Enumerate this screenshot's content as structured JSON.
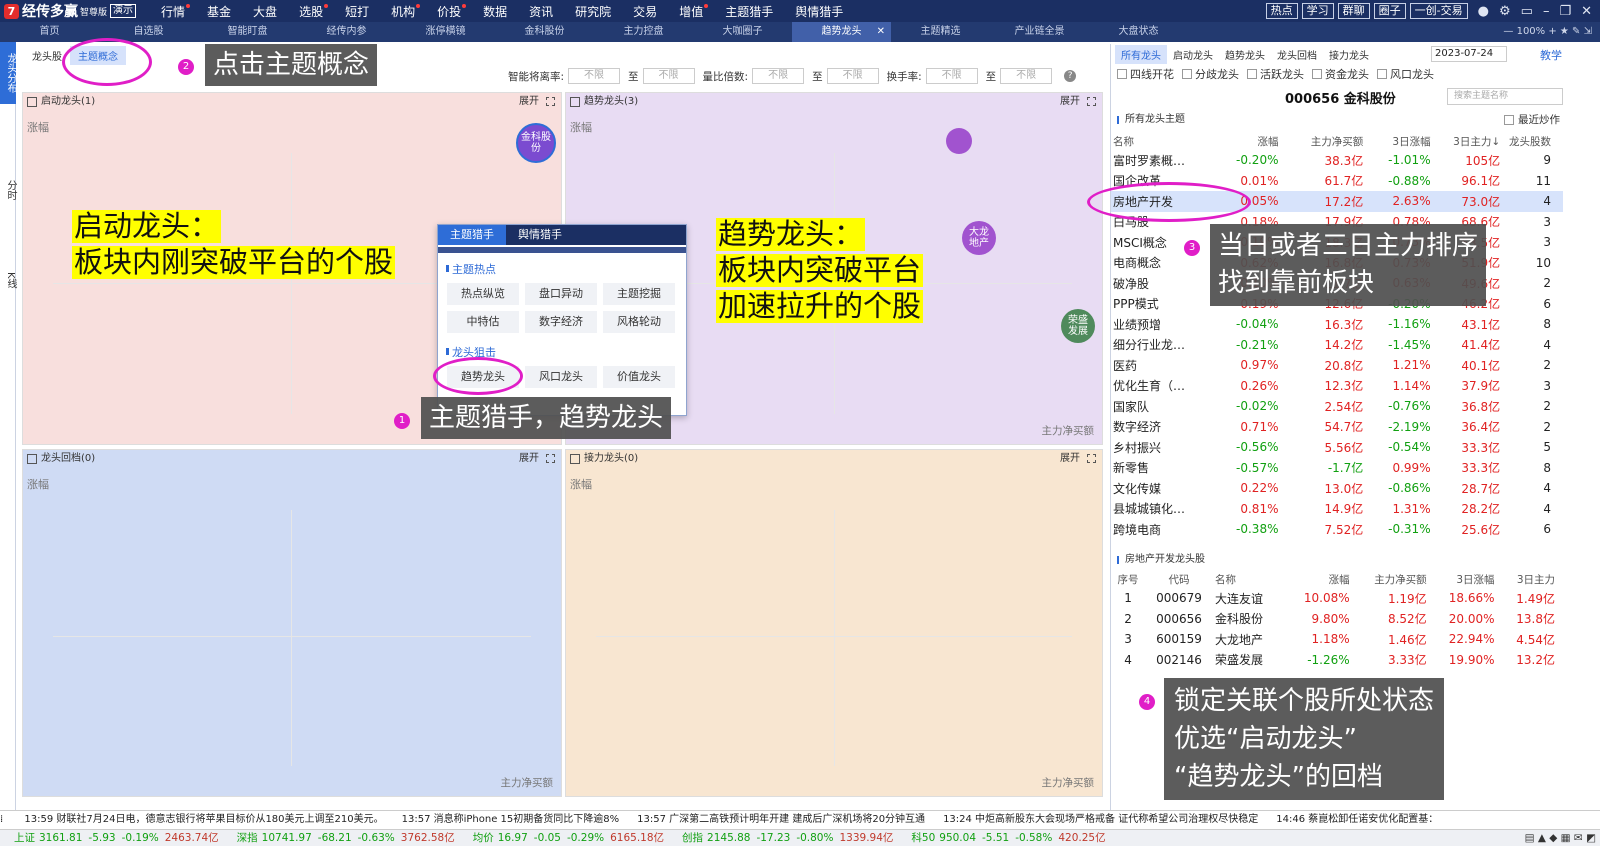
{
  "app": {
    "brand": "经传多赢",
    "edition": "智尊版",
    "demo": "演示"
  },
  "menu": [
    {
      "label": "行情",
      "dot": true
    },
    {
      "label": "基金",
      "dot": false
    },
    {
      "label": "大盘",
      "dot": false
    },
    {
      "label": "选股",
      "dot": true
    },
    {
      "label": "短打",
      "dot": false
    },
    {
      "label": "机构",
      "dot": true
    },
    {
      "label": "价投",
      "dot": true
    },
    {
      "label": "数据",
      "dot": false
    },
    {
      "label": "资讯",
      "dot": false
    },
    {
      "label": "研究院",
      "dot": false
    },
    {
      "label": "交易",
      "dot": false
    },
    {
      "label": "增值",
      "dot": true
    },
    {
      "label": "主题猎手",
      "dot": false
    },
    {
      "label": "舆情猎手",
      "dot": false
    }
  ],
  "toolbar": {
    "buttons": [
      "热点",
      "学习",
      "群聊",
      "圈子",
      "一创-交易"
    ]
  },
  "tabs": [
    {
      "label": "首页",
      "active": false
    },
    {
      "label": "自选股",
      "active": false
    },
    {
      "label": "智能盯盘",
      "active": false
    },
    {
      "label": "经传内参",
      "active": false
    },
    {
      "label": "涨停横镜",
      "active": false
    },
    {
      "label": "金科股份",
      "active": false
    },
    {
      "label": "主力控盘",
      "active": false
    },
    {
      "label": "大咖圈子",
      "active": false
    },
    {
      "label": "趋势龙头",
      "active": true
    },
    {
      "label": "主题精选",
      "active": false
    },
    {
      "label": "产业链全景",
      "active": false
    },
    {
      "label": "大盘状态",
      "active": false
    }
  ],
  "zoom": "100%",
  "leftside": [
    "龙头分布",
    "分时",
    "K线"
  ],
  "subtabs": [
    {
      "label": "龙头股",
      "active": false
    },
    {
      "label": "主题概念",
      "active": true
    }
  ],
  "filters": {
    "f1": "智能将离率:",
    "f2": "量比倍数:",
    "f3": "换手率:",
    "placeholder": "不限",
    "to": "至"
  },
  "quadrants": {
    "q1": {
      "title": "启动龙头(1)",
      "expand": "展开",
      "ylabel": "涨幅",
      "xlabel": ""
    },
    "q2": {
      "title": "趋势龙头(3)",
      "expand": "展开",
      "ylabel": "涨幅",
      "xlabel": "主力净买额"
    },
    "q3": {
      "title": "龙头回档(0)",
      "expand": "展开",
      "ylabel": "涨幅",
      "xlabel": "主力净买额"
    },
    "q4": {
      "title": "接力龙头(0)",
      "expand": "展开",
      "ylabel": "涨幅",
      "xlabel": "主力净买额"
    }
  },
  "bubbles": {
    "b1": "金科股份",
    "b2": "大龙地产",
    "b3": "荣盛发展"
  },
  "popup": {
    "tab1": "主题猎手",
    "tab2": "舆情猎手",
    "sec1": "主题热点",
    "row1": [
      "热点纵览",
      "盘口异动",
      "主题挖掘"
    ],
    "row2": [
      "中特估",
      "数字经济",
      "风格轮动"
    ],
    "sec2": "龙头狙击",
    "row3": [
      "趋势龙头",
      "风口龙头",
      "价值龙头"
    ]
  },
  "annotations": {
    "a1": "启动龙头：",
    "a1b": "板块内刚突破平台的个股",
    "a2": "趋势龙头：",
    "a2b": "板块内突破平台",
    "a2c": "加速拉升的个股",
    "n1": "主题猎手，趋势龙头",
    "n2": "点击主题概念",
    "n3a": "当日或者三日主力排序",
    "n3b": "找到靠前板块",
    "n4a": "锁定关联个股所处状态",
    "n4b": "优选“启动龙头”",
    "n4c": "“趋势龙头”的回档",
    "num1": "1",
    "num2": "2",
    "num3": "3",
    "num4": "4"
  },
  "right": {
    "tabs": [
      {
        "label": "所有龙头",
        "active": true
      },
      {
        "label": "启动龙头",
        "active": false
      },
      {
        "label": "趋势龙头",
        "active": false
      },
      {
        "label": "龙头回档",
        "active": false
      },
      {
        "label": "接力龙头",
        "active": false
      }
    ],
    "date": "2023-07-24",
    "teach": "教学",
    "checks": [
      "四线开花",
      "分歧龙头",
      "活跃龙头",
      "资金龙头",
      "风口龙头"
    ],
    "stock": "000656 金科股份",
    "search_placeholder": "搜索主题名称",
    "section1": "所有龙头主题",
    "recent": "最近炒作",
    "headers": [
      "名称",
      "涨幅",
      "主力净买额",
      "3日涨幅",
      "3日主力↓",
      "龙头股数"
    ],
    "rows": [
      [
        "富时罗素概…",
        "-0.20%",
        "38.3亿",
        "-1.01%",
        "105亿",
        "9"
      ],
      [
        "国企改革",
        "0.01%",
        "61.7亿",
        "-0.88%",
        "96.1亿",
        "11"
      ],
      [
        "房地产开发",
        "0.05%",
        "17.2亿",
        "2.63%",
        "73.0亿",
        "4"
      ],
      [
        "白马股",
        "0.18%",
        "17.9亿",
        "0.78%",
        "68.6亿",
        "3"
      ],
      [
        "MSCI概念",
        "0.19%",
        "18.3亿",
        "0.73%",
        "53.5亿",
        "3"
      ],
      [
        "电商概念",
        "0.62%",
        "16.8亿",
        "0.73%",
        "51.9亿",
        "10"
      ],
      [
        "破净股",
        "0.10%",
        "11.7亿",
        "0.63%",
        "49.6亿",
        "2"
      ],
      [
        "PPP模式",
        "0.19%",
        "12.6亿",
        "-0.20%",
        "46.2亿",
        "6"
      ],
      [
        "业绩预增",
        "-0.04%",
        "16.3亿",
        "-1.16%",
        "43.1亿",
        "8"
      ],
      [
        "细分行业龙…",
        "-0.21%",
        "14.2亿",
        "-1.45%",
        "41.4亿",
        "4"
      ],
      [
        "医药",
        "0.97%",
        "20.8亿",
        "1.21%",
        "40.1亿",
        "2"
      ],
      [
        "优化生育（…",
        "0.26%",
        "12.3亿",
        "1.14%",
        "37.9亿",
        "3"
      ],
      [
        "国家队",
        "-0.02%",
        "2.54亿",
        "-0.76%",
        "36.8亿",
        "2"
      ],
      [
        "数字经济",
        "0.71%",
        "54.7亿",
        "-2.19%",
        "36.4亿",
        "2"
      ],
      [
        "乡村振兴",
        "-0.56%",
        "5.56亿",
        "-0.54%",
        "33.3亿",
        "5"
      ],
      [
        "新零售",
        "-0.57%",
        "-1.7亿",
        "0.99%",
        "33.3亿",
        "8"
      ],
      [
        "文化传媒",
        "0.22%",
        "13.0亿",
        "-0.86%",
        "28.7亿",
        "4"
      ],
      [
        "县城城镇化…",
        "0.81%",
        "14.9亿",
        "1.31%",
        "28.2亿",
        "4"
      ],
      [
        "跨境电商",
        "-0.38%",
        "7.52亿",
        "-0.31%",
        "25.6亿",
        "6"
      ]
    ],
    "section2": "房地产开发龙头股",
    "headers2": [
      "序号",
      "代码",
      "名称",
      "涨幅",
      "主力净买额",
      "3日涨幅",
      "3日主力"
    ],
    "rows2": [
      [
        "1",
        "000679",
        "大连友谊",
        "10.08%",
        "1.19亿",
        "18.66%",
        "1.49亿"
      ],
      [
        "2",
        "000656",
        "金科股份",
        "9.80%",
        "8.52亿",
        "20.00%",
        "13.8亿"
      ],
      [
        "3",
        "600159",
        "大龙地产",
        "1.18%",
        "1.46亿",
        "22.94%",
        "4.54亿"
      ],
      [
        "4",
        "002146",
        "荣盛发展",
        "-1.26%",
        "3.33亿",
        "19.90%",
        "13.2亿"
      ]
    ]
  },
  "news": [
    "13:59 财联社7月24日电，德意志银行将苹果目标价从180美元上调至210美元。",
    "13:57 消息称iPhone 15初期备货同比下降逾8%",
    "13:57 广深第二高铁预计明年开建 建成后广深机场将20分钟互通",
    "13:24 中炬高新股东大会现场严格戒备 证代称希望公司治理权尽快稳定",
    "14:46 蔡崑松卸任诺安优化配置基："
  ],
  "indices": [
    {
      "name": "上证",
      "val": "3161.81",
      "chg": "-5.93",
      "pct": "-0.19%",
      "amt": "2463.74亿"
    },
    {
      "name": "深指",
      "val": "10741.97",
      "chg": "-68.21",
      "pct": "-0.63%",
      "amt": "3762.58亿"
    },
    {
      "name": "均价",
      "val": "16.97",
      "chg": "-0.05",
      "pct": "-0.29%",
      "amt": "6165.18亿"
    },
    {
      "name": "创指",
      "val": "2145.88",
      "chg": "-17.23",
      "pct": "-0.80%",
      "amt": "1339.94亿"
    },
    {
      "name": "科50",
      "val": "950.04",
      "chg": "-5.51",
      "pct": "-0.58%",
      "amt": "420.25亿"
    }
  ],
  "colors": {
    "q1": "#f8dfdd",
    "q2": "#e8dcf3",
    "q3": "#cfdbf4",
    "q4": "#f8e6d1",
    "accent": "#2e6dd7",
    "magenta": "#e01ec7",
    "highlight": "#ffff00"
  }
}
